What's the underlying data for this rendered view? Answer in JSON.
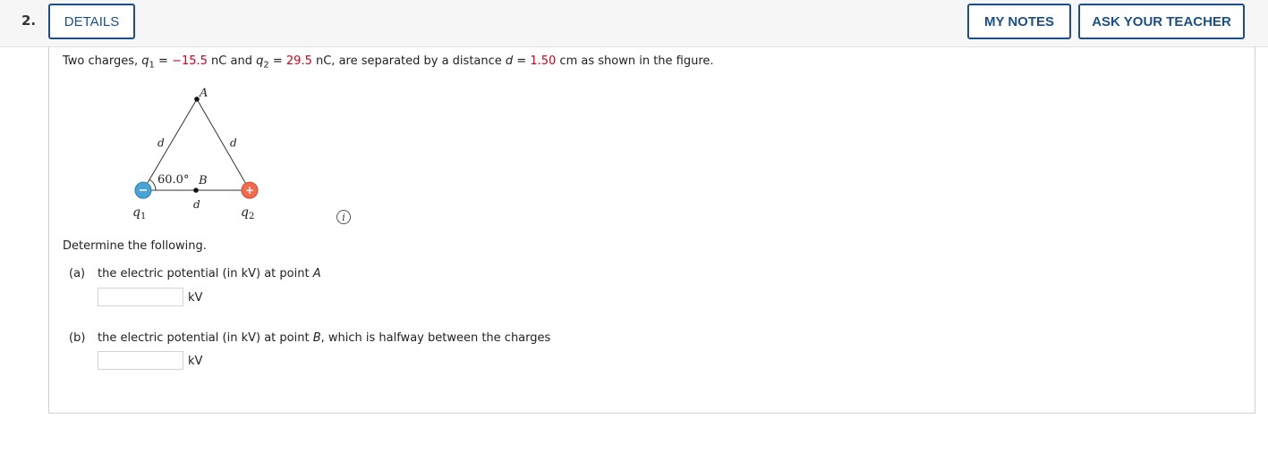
{
  "header": {
    "question_number": "2.",
    "details_label": "DETAILS",
    "my_notes_label": "MY NOTES",
    "ask_teacher_label": "ASK YOUR TEACHER"
  },
  "problem": {
    "intro": "Two charges, ",
    "q1_symbol": "q",
    "q1_sub": "1",
    "eq1": " = ",
    "q1_value": "−15.5",
    "q1_unit": " nC and ",
    "q2_symbol": "q",
    "q2_sub": "2",
    "eq2": " = ",
    "q2_value": "29.5",
    "q2_unit": " nC, are separated by a distance ",
    "d_symbol": "d",
    "eq3": " = ",
    "d_value": "1.50",
    "d_tail": " cm as shown in the figure."
  },
  "figure": {
    "label_A": "A",
    "label_B": "B",
    "label_d_left": "d",
    "label_d_right": "d",
    "label_d_bottom": "d",
    "angle_label": "60.0°",
    "q1_label": "q",
    "q1_sub": "1",
    "q2_label": "q",
    "q2_sub": "2",
    "negative_sign": "−",
    "positive_sign": "+",
    "info_symbol": "i"
  },
  "instructions": "Determine the following.",
  "parts": [
    {
      "label": "(a)",
      "text_before": "the electric potential (in kV) at point ",
      "point": "A",
      "text_after": "",
      "input_value": "",
      "unit": "kV"
    },
    {
      "label": "(b)",
      "text_before": "the electric potential (in kV) at point ",
      "point": "B",
      "text_after": ", which is halfway between the charges",
      "input_value": "",
      "unit": "kV"
    }
  ],
  "colors": {
    "accent": "#1a4f8b",
    "value_red": "#d0021b",
    "negative_charge": "#4aa3d6",
    "positive_charge": "#f26b4e"
  }
}
